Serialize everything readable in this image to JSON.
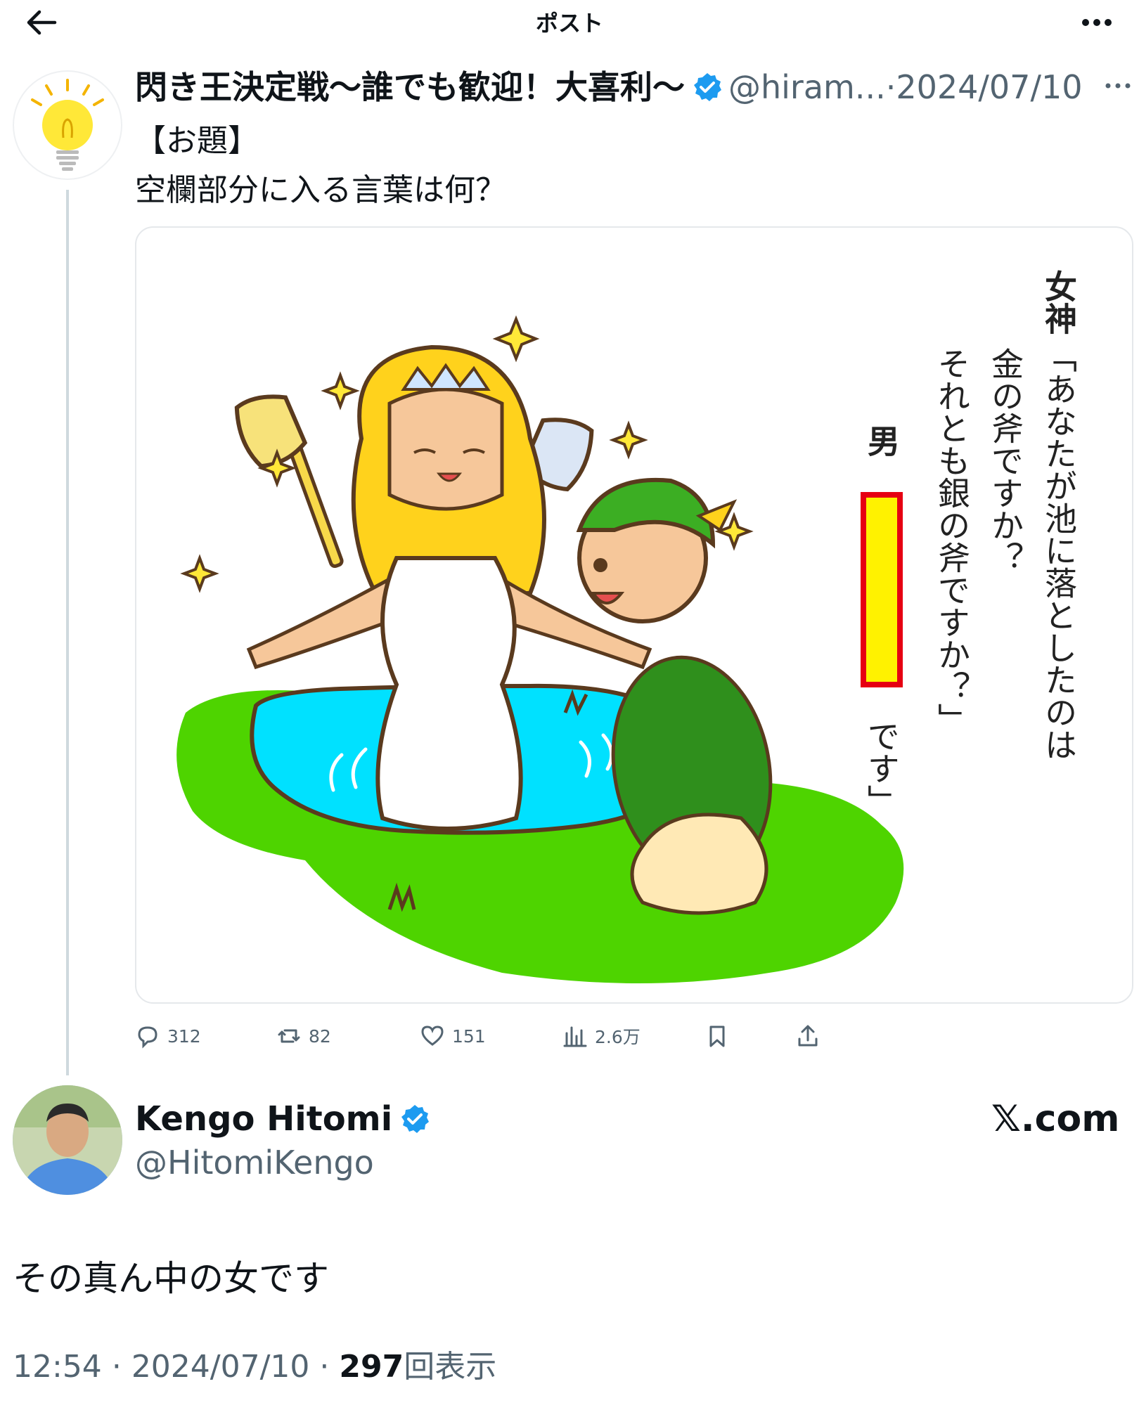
{
  "header": {
    "title": "ポスト",
    "back_icon": "arrow-left-icon",
    "more_icon": "more-horizontal-icon"
  },
  "post1": {
    "author_name": "閃き王決定戦〜誰でも歓迎！大喜利〜",
    "handle": "@hiram...",
    "separator": "·",
    "date": "2024/07/10",
    "more_label": "…",
    "body_line1": "【お題】",
    "body_line2": "空欄部分に入る言葉は何？",
    "image": {
      "goddess_speaker": "女神",
      "goddess_line1": "「あなたが池に落としたのは",
      "goddess_line2": "金の斧ですか？",
      "goddess_line3": "それとも銀の斧ですか？」",
      "man_speaker": "男",
      "man_open": "「",
      "man_close": "です」"
    },
    "actions": {
      "replies": "312",
      "reposts": "82",
      "likes": "151",
      "views": "2.6万"
    }
  },
  "post2": {
    "author_name": "Kengo Hitomi",
    "handle": "@HitomiKengo",
    "brand": "𝕏.com",
    "text": "その真ん中の女です",
    "time": "12:54",
    "separator": "·",
    "date": "2024/07/10",
    "views_count": "297",
    "views_label": "回表示"
  },
  "colors": {
    "verified": "#1d9bf0",
    "secondary_text": "#536471",
    "pond": "#00e1ff",
    "grass": "#4ed400",
    "blank_fill": "#fff200",
    "blank_border": "#e60012"
  }
}
